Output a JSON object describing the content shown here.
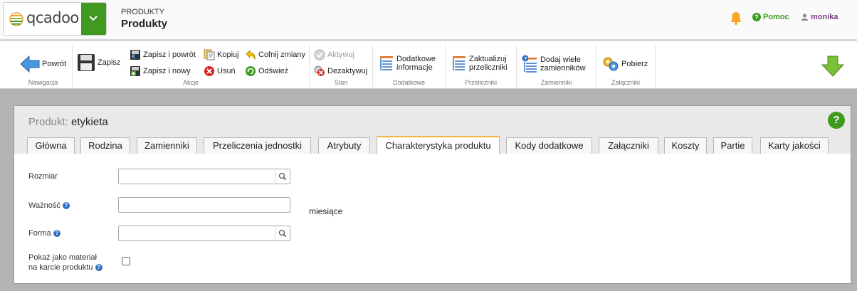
{
  "brand": {
    "logo_text": "qcadoo",
    "accent": "#3f9a1f"
  },
  "header": {
    "module": "PRODUKTY",
    "title": "Produkty",
    "help": "Pomoc",
    "user": "monika"
  },
  "ribbon": {
    "groups": [
      {
        "label": "Nawigacja",
        "buttons": [
          {
            "label": "Powrót",
            "icon": "back-arrow-icon"
          }
        ]
      },
      {
        "label": "Akcje",
        "buttons": [
          {
            "label": "Zapisz",
            "icon": "save-icon"
          },
          {
            "label": "Zapisz i powrót",
            "icon": "save-return-icon"
          },
          {
            "label": "Zapisz i nowy",
            "icon": "save-new-icon"
          },
          {
            "label": "Kopiuj",
            "icon": "copy-icon"
          },
          {
            "label": "Usuń",
            "icon": "delete-icon"
          },
          {
            "label": "Cofnij zmiany",
            "icon": "undo-icon"
          },
          {
            "label": "Odśwież",
            "icon": "refresh-icon"
          }
        ]
      },
      {
        "label": "Stan",
        "buttons": [
          {
            "label": "Aktywuj",
            "icon": "activate-icon",
            "disabled": true
          },
          {
            "label": "Dezaktywuj",
            "icon": "deactivate-icon"
          }
        ]
      },
      {
        "label": "Dodatkowe",
        "buttons": [
          {
            "label": "Dodatkowe informacje",
            "line1": "Dodatkowe",
            "line2": "informacje",
            "icon": "list-icon"
          }
        ]
      },
      {
        "label": "Przeliczniki",
        "buttons": [
          {
            "label": "Zaktualizuj przeliczniki",
            "line1": "Zaktualizuj",
            "line2": "przeliczniki",
            "icon": "list-icon"
          }
        ]
      },
      {
        "label": "Zamienniki",
        "buttons": [
          {
            "label": "Dodaj wiele zamienników",
            "line1": "Dodaj wiele",
            "line2": "zamienników",
            "icon": "list-info-icon"
          }
        ]
      },
      {
        "label": "Załączniki",
        "buttons": [
          {
            "label": "Pobierz",
            "icon": "gears-icon"
          }
        ]
      }
    ]
  },
  "product": {
    "prefix": "Produkt:",
    "name": "etykieta"
  },
  "tabs": [
    {
      "label": "Główna"
    },
    {
      "label": "Rodzina"
    },
    {
      "label": "Zamienniki"
    },
    {
      "label": "Przeliczenia jednostki"
    },
    {
      "label": "Atrybuty"
    },
    {
      "label": "Charakterystyka produktu",
      "active": true
    },
    {
      "label": "Kody dodatkowe"
    },
    {
      "label": "Załączniki"
    },
    {
      "label": "Koszty"
    },
    {
      "label": "Partie"
    },
    {
      "label": "Karty jakości"
    }
  ],
  "form": {
    "size": {
      "label": "Rozmiar",
      "value": ""
    },
    "validity": {
      "label": "Ważność",
      "value": "",
      "unit": "miesiące"
    },
    "form": {
      "label": "Forma",
      "value": ""
    },
    "show_material": {
      "label_line1": "Pokaż jako materiał",
      "label_line2": "na karcie produktu",
      "checked": false
    }
  }
}
